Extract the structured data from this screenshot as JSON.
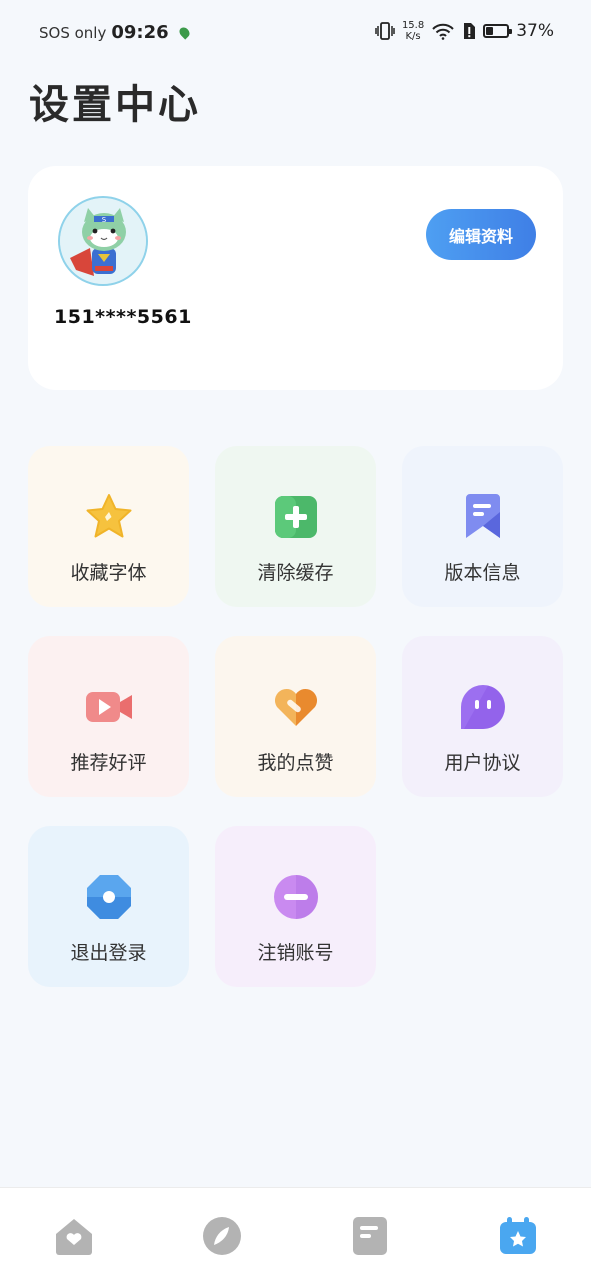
{
  "status_bar": {
    "carrier": "SOS only",
    "time": "09:26",
    "speed_value": "15.8",
    "speed_unit": "K/s",
    "battery_percent": "37%",
    "battery_level": 0.37
  },
  "page": {
    "title": "设置中心"
  },
  "profile": {
    "phone": "151****5561",
    "edit_label": "编辑资料"
  },
  "menu": {
    "items": [
      {
        "label": "收藏字体",
        "icon": "star-icon"
      },
      {
        "label": "清除缓存",
        "icon": "plus-square-icon"
      },
      {
        "label": "版本信息",
        "icon": "bookmark-icon"
      },
      {
        "label": "推荐好评",
        "icon": "video-camera-icon"
      },
      {
        "label": "我的点赞",
        "icon": "heart-icon"
      },
      {
        "label": "用户协议",
        "icon": "chat-bubble-icon"
      },
      {
        "label": "退出登录",
        "icon": "octagon-icon"
      },
      {
        "label": "注销账号",
        "icon": "minus-circle-icon"
      }
    ]
  },
  "tabbar": {
    "tabs": [
      {
        "icon": "home-icon",
        "active": false
      },
      {
        "icon": "compass-icon",
        "active": false
      },
      {
        "icon": "document-icon",
        "active": false
      },
      {
        "icon": "calendar-star-icon",
        "active": true
      }
    ]
  },
  "colors": {
    "accent": "#4a90ee",
    "background": "#f5f8fc",
    "tab_inactive": "#b3b3b3",
    "tab_active": "#4aa7f0"
  }
}
